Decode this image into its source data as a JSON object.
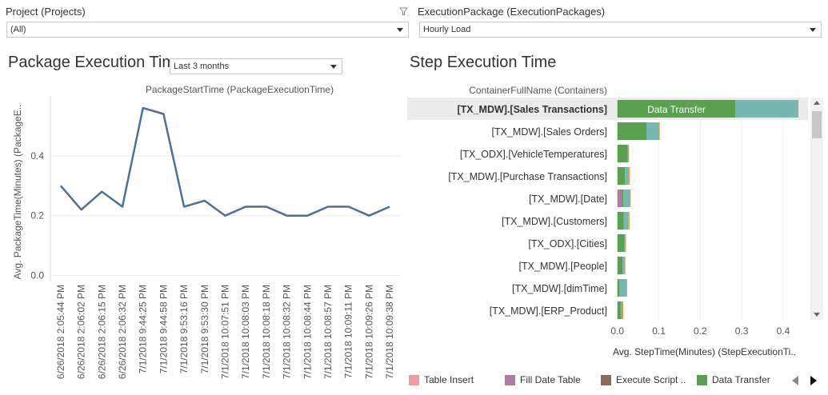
{
  "filters": {
    "project": {
      "label": "Project (Projects)",
      "value": "(All)"
    },
    "execution_package": {
      "label": "ExecutionPackage (ExecutionPackages)",
      "value": "Hourly Load"
    }
  },
  "package_sheet": {
    "title": "Package Execution Time",
    "date_range": "Last 3 months"
  },
  "step_sheet": {
    "title": "Step Execution Time"
  },
  "legend": [
    {
      "label": "Table Insert",
      "color": "#f59aa4"
    },
    {
      "label": "Fill Date Table",
      "color": "#b07aa1"
    },
    {
      "label": "Execute Script ..",
      "color": "#8c6b5b"
    },
    {
      "label": "Data Transfer",
      "color": "#59a14f"
    }
  ],
  "chart_data": [
    {
      "type": "line",
      "title": "PackageStartTime (PackageExecutionTime)",
      "xlabel": "",
      "ylabel": "Avg. PackageTime(Minutes) (PackageE..",
      "categories": [
        "6/26/2018 2:05:44 PM",
        "6/26/2018 2:06:02 PM",
        "6/26/2018 2:06:15 PM",
        "6/26/2018 2:06:32 PM",
        "7/1/2018 9:44:25 PM",
        "7/1/2018 9:44:58 PM",
        "7/1/2018 9:53:16 PM",
        "7/1/2018 9:53:30 PM",
        "7/1/2018 10:07:51 PM",
        "7/1/2018 10:08:03 PM",
        "7/1/2018 10:08:18 PM",
        "7/1/2018 10:08:32 PM",
        "7/1/2018 10:08:44 PM",
        "7/1/2018 10:08:57 PM",
        "7/1/2018 10:09:11 PM",
        "7/1/2018 10:09:26 PM",
        "7/1/2018 10:09:38 PM"
      ],
      "values": [
        0.3,
        0.22,
        0.28,
        0.23,
        0.56,
        0.54,
        0.23,
        0.25,
        0.2,
        0.23,
        0.23,
        0.2,
        0.2,
        0.23,
        0.23,
        0.2,
        0.23
      ],
      "yticks": [
        0.0,
        0.2,
        0.4
      ],
      "ytick_labels": [
        "0.0",
        "0.2",
        "0.4"
      ],
      "ylim": [
        -0.02,
        0.6
      ],
      "grid": true,
      "color": "#4e6f96"
    },
    {
      "type": "bar",
      "orientation": "horizontal",
      "stacked": true,
      "title": "ContainerFullName (Containers)",
      "xlabel": "Avg. StepTime(Minutes) (StepExecutionTi..",
      "categories": [
        "[TX_MDW].[Sales Transactions]",
        "[TX_MDW].[Sales Orders]",
        "[TX_ODX].[VehicleTemperatures]",
        "[TX_MDW].[Purchase Transactions]",
        "[TX_MDW].[Date]",
        "[TX_MDW].[Customers]",
        "[TX_ODX].[Cities]",
        "[TX_MDW].[People]",
        "[TX_MDW].[dimTime]",
        "[TX_MDW].[ERP_Product]"
      ],
      "series": [
        {
          "name": "Fill Date Table",
          "color": "#b07aa1",
          "values": [
            0,
            0,
            0,
            0,
            0.012,
            0,
            0,
            0,
            0,
            0
          ]
        },
        {
          "name": "Data Transfer",
          "color": "#59a14f",
          "values": [
            0.285,
            0.07,
            0.025,
            0.018,
            0.002,
            0.015,
            0.017,
            0.012,
            0.005,
            0.008
          ]
        },
        {
          "name": "",
          "color": "#76b7b2",
          "values": [
            0.15,
            0.03,
            0.001,
            0.01,
            0.016,
            0.012,
            0.002,
            0.005,
            0.017,
            0.004
          ]
        },
        {
          "name": "",
          "color": "#f28e2b",
          "values": [
            0.002,
            0.002,
            0.002,
            0.002,
            0.002,
            0.002,
            0.001,
            0.002,
            0.001,
            0.002
          ]
        }
      ],
      "highlighted_category": "[TX_MDW].[Sales Transactions]",
      "bar_label": "Data Transfer",
      "xticks": [
        0.0,
        0.1,
        0.2,
        0.3,
        0.4
      ],
      "xtick_labels": [
        "0.0",
        "0.1",
        "0.2",
        "0.3",
        "0.4"
      ],
      "xlim": [
        -0.015,
        0.46
      ],
      "grid": true
    }
  ]
}
